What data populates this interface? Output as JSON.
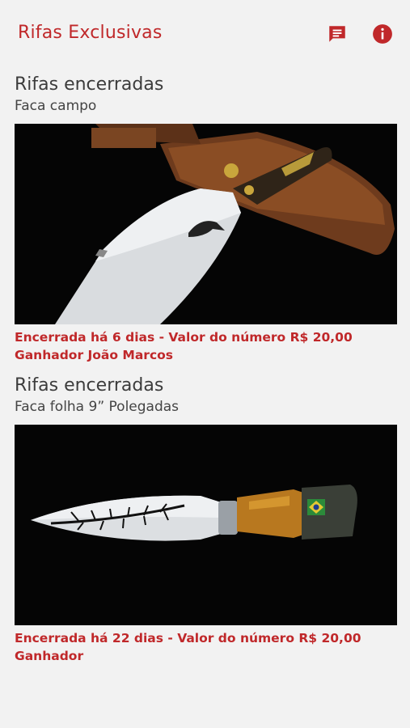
{
  "app": {
    "title": "Rifas Exclusivas",
    "actions": [
      {
        "icon": "chat-icon"
      },
      {
        "icon": "info-icon"
      }
    ]
  },
  "raffles": [
    {
      "heading": "Rifas encerradas",
      "name": "Faca campo",
      "status": "Encerrada há 6 dias - Valor do número R$ 20,00",
      "winner": "Ganhador João Marcos"
    },
    {
      "heading": "Rifas encerradas",
      "name": "Faca folha 9” Polegadas",
      "status": "Encerrada há 22 dias - Valor do número R$ 20,00",
      "winner": "Ganhador"
    }
  ],
  "colors": {
    "accent": "#c0282a",
    "background": "#f2f2f2",
    "photo_background": "#050505"
  }
}
